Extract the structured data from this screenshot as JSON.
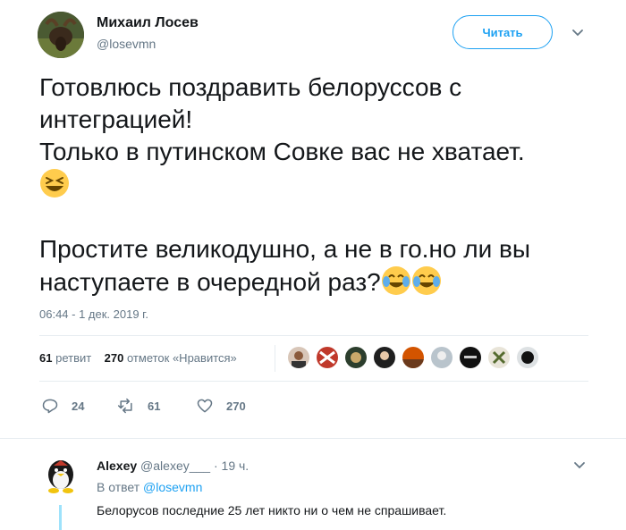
{
  "author": {
    "name": "Михаил Лосев",
    "handle": "@losevmn"
  },
  "follow_button": {
    "label": "Читать"
  },
  "tweet": {
    "lines": [
      "Готовлюсь поздравить белоруссов с",
      "интеграцией!",
      "Только в путинском Совке вас не хватает."
    ],
    "line2a": "Простите великодушно, а не в го.но ли вы",
    "line2b": "наступаете в очередной раз?",
    "timestamp": "06:44 - 1 дек. 2019 г."
  },
  "stats": {
    "retweets_count": "61",
    "retweets_label": "ретвит",
    "likes_count": "270",
    "likes_label": "отметок «Нравится»"
  },
  "actions": {
    "replies": "24",
    "retweets": "61",
    "likes": "270"
  },
  "reply": {
    "name": "Alexey",
    "handle": "@alexey___",
    "time": "· 19 ч.",
    "reply_to_prefix": "В ответ",
    "reply_to_handle": "@losevmn",
    "text": "Белорусов последние 25 лет никто ни о чем не спрашивает."
  },
  "colors": {
    "accent": "#1da1f2",
    "secondary_text": "#657786",
    "divider": "#e6ecf0"
  },
  "icons": {
    "reply": "reply-icon",
    "retweet": "retweet-icon",
    "like": "heart-icon",
    "menu": "chevron-down-icon"
  }
}
